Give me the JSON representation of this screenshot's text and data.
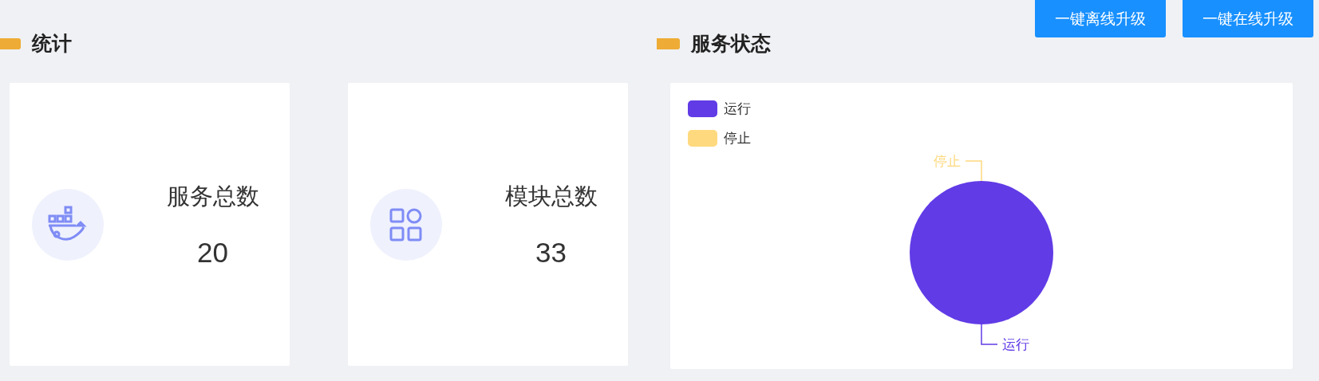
{
  "statistics": {
    "title": "统计",
    "cards": [
      {
        "kind": "whale",
        "label": "服务总数",
        "value": "20"
      },
      {
        "kind": "grid",
        "label": "模块总数",
        "value": "33"
      }
    ]
  },
  "service_status": {
    "title": "服务状态",
    "buttons": [
      "一键离线升级",
      "一键在线升级"
    ],
    "legend": [
      {
        "label": "运行",
        "color": "#613be6"
      },
      {
        "label": "停止",
        "color": "#fed97e"
      }
    ],
    "pie": [
      {
        "label": "运行",
        "color": "#613be6"
      },
      {
        "label": "停止",
        "color": "#fed97e"
      }
    ]
  }
}
